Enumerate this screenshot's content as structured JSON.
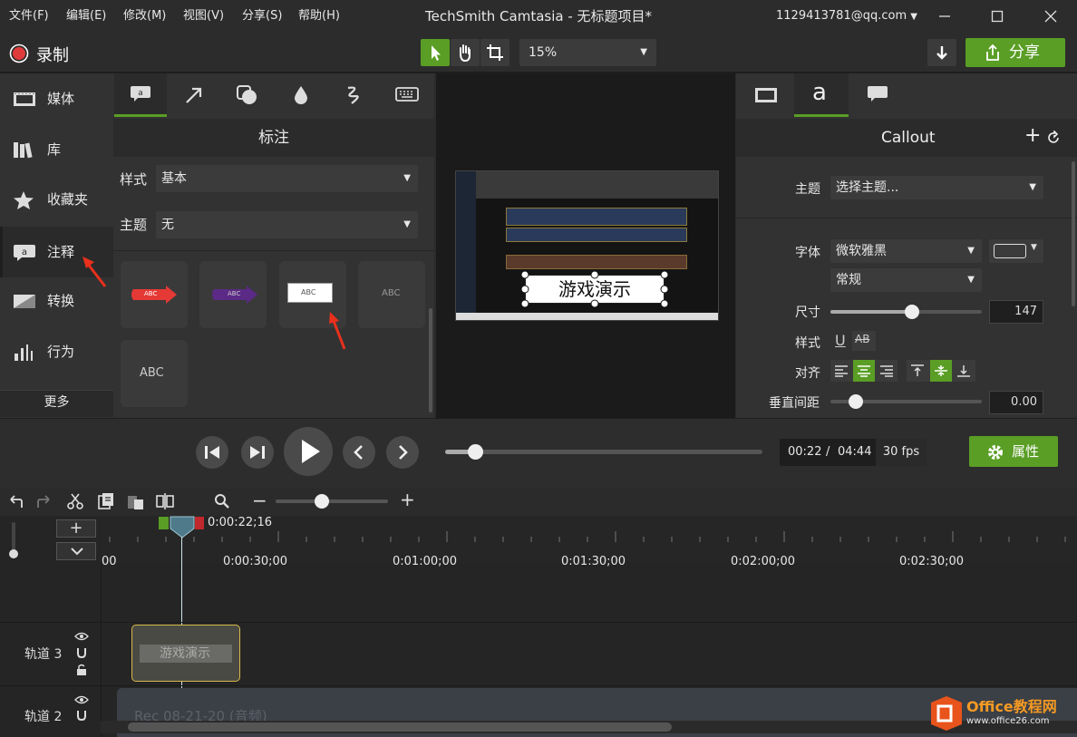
{
  "menu": {
    "items": [
      "文件(F)",
      "编辑(E)",
      "修改(M)",
      "视图(V)",
      "分享(S)",
      "帮助(H)"
    ]
  },
  "window": {
    "title": "TechSmith Camtasia - 无标题项目*",
    "account": "1129413781@qq.com"
  },
  "toolbar": {
    "record_label": "录制",
    "zoom_value": "15%",
    "share_label": "分享"
  },
  "nav": {
    "items": [
      "媒体",
      "库",
      "收藏夹",
      "注释",
      "转换",
      "行为"
    ],
    "more_label": "更多",
    "active": "注释"
  },
  "annotations": {
    "header": "标注",
    "style_label": "样式",
    "style_value": "基本",
    "theme_label": "主题",
    "theme_value": "无",
    "tile_text": "ABC"
  },
  "canvas": {
    "callout_text": "游戏演示"
  },
  "properties": {
    "header": "Callout",
    "theme_label": "主题",
    "theme_value": "选择主题...",
    "font_label": "字体",
    "font_value": "微软雅黑",
    "font_style_value": "常规",
    "size_label": "尺寸",
    "size_value": "147",
    "style_label": "样式",
    "align_label": "对齐",
    "spacing_label": "垂直间距",
    "spacing_value": "0.00"
  },
  "playback": {
    "current": "00:22",
    "separator": "/",
    "total": "04:44",
    "fps": "30 fps",
    "properties_label": "属性"
  },
  "timeline": {
    "playhead_time": "0:00:22;16",
    "ruler_labels": [
      "00",
      "0:00:30;00",
      "0:01:00;00",
      "0:01:30;00",
      "0:02:00;00",
      "0:02:30;00"
    ],
    "tracks": [
      {
        "name": "轨道 3",
        "clip_label": "游戏演示"
      },
      {
        "name": "轨道 2",
        "clip_label": "Rec 08-21-20 (音频)"
      }
    ]
  },
  "watermark": {
    "brand": "Office教程网",
    "url": "www.office26.com"
  },
  "colors": {
    "accent": "#5a9e25",
    "record": "#e03b3b",
    "bg": "#2b2b2b",
    "panel": "#323232"
  }
}
